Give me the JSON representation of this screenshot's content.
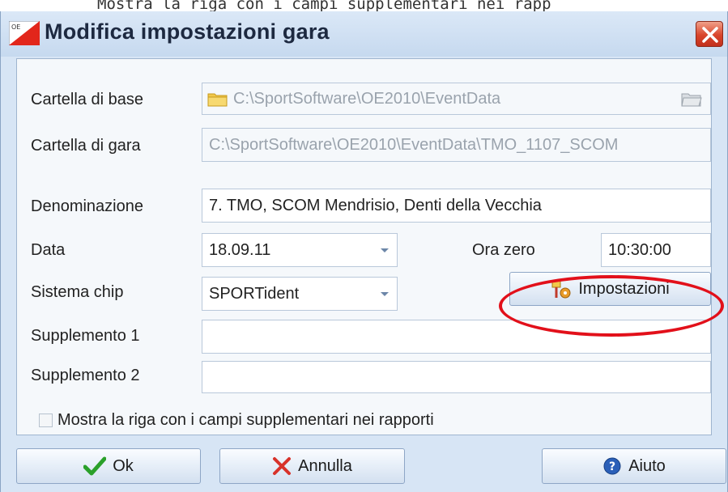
{
  "caption": "Mostra la riga con i campi supplementari nei rapp",
  "window": {
    "title": "Modifica impostazioni gara",
    "app_icon": "oe-flag-icon",
    "close_icon": "close-icon"
  },
  "form": {
    "base_folder": {
      "label": "Cartella di base",
      "value": "C:\\SportSoftware\\OE2010\\EventData"
    },
    "event_folder": {
      "label": "Cartella di gara",
      "value": "C:\\SportSoftware\\OE2010\\EventData\\TMO_1107_SCOM"
    },
    "name": {
      "label": "Denominazione",
      "value": "7. TMO, SCOM Mendrisio, Denti della Vecchia"
    },
    "date": {
      "label": "Data",
      "value": "18.09.11"
    },
    "zero_time": {
      "label": "Ora zero",
      "value": "10:30:00"
    },
    "chip_system": {
      "label": "Sistema chip",
      "value": "SPORTident"
    },
    "settings_button": {
      "label": "Impostazioni"
    },
    "supplement1": {
      "label": "Supplemento 1",
      "value": ""
    },
    "supplement2": {
      "label": "Supplemento 2",
      "value": ""
    },
    "show_row": {
      "label": "Mostra la riga con i campi supplementari nei rapporti",
      "checked": false
    }
  },
  "buttons": {
    "ok": "Ok",
    "cancel": "Annulla",
    "help": "Aiuto"
  },
  "colors": {
    "ring": "#e2101a",
    "ok_check": "#2aa02a",
    "cancel_x": "#d8322a",
    "help_icon": "#2a5fb8"
  }
}
